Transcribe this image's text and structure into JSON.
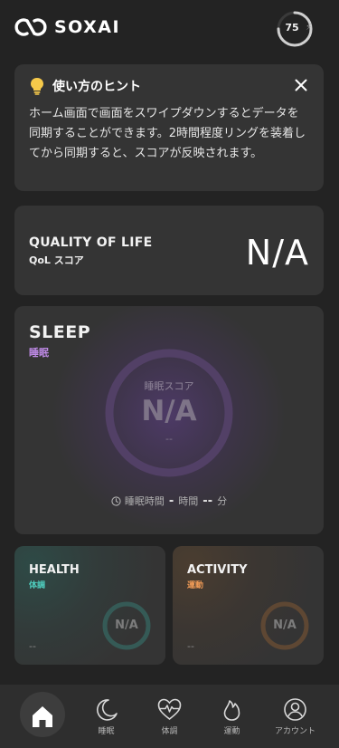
{
  "header": {
    "app_name": "SOXAI",
    "battery_level": "75",
    "battery_fraction": 0.75
  },
  "hint": {
    "title": "使い方のヒント",
    "body": "ホーム画面で画面をスワイプダウンするとデータを同期することができます。2時間程度リングを装着してから同期すると、スコアが反映されます。",
    "close_icon": "close-icon",
    "bulb_icon": "lightbulb-icon"
  },
  "qol": {
    "title": "QUALITY OF LIFE",
    "subtitle": "QoL スコア",
    "value": "N/A"
  },
  "sleep": {
    "title": "SLEEP",
    "subtitle": "睡眠",
    "score_label": "睡眠スコア",
    "score_value": "N/A",
    "score_sub": "--",
    "time_label": "睡眠時間",
    "hours_value": "-",
    "hours_unit": "時間",
    "minutes_value": "--",
    "minutes_unit": "分"
  },
  "health": {
    "title": "HEALTH",
    "subtitle": "体調",
    "value": "N/A",
    "sub_value": "--"
  },
  "activity": {
    "title": "ACTIVITY",
    "subtitle": "運動",
    "value": "N/A",
    "sub_value": "--"
  },
  "tabs": [
    {
      "label": "",
      "icon": "home-icon",
      "active": true
    },
    {
      "label": "睡眠",
      "icon": "moon-icon"
    },
    {
      "label": "体調",
      "icon": "heart-pulse-icon"
    },
    {
      "label": "運動",
      "icon": "flame-icon"
    },
    {
      "label": "アカウント",
      "icon": "account-icon"
    }
  ],
  "colors": {
    "background": "#232323",
    "card": "#343434",
    "sleep_accent": "#c08be8",
    "health_accent": "#4fcfc0",
    "activity_accent": "#ef9a56"
  }
}
